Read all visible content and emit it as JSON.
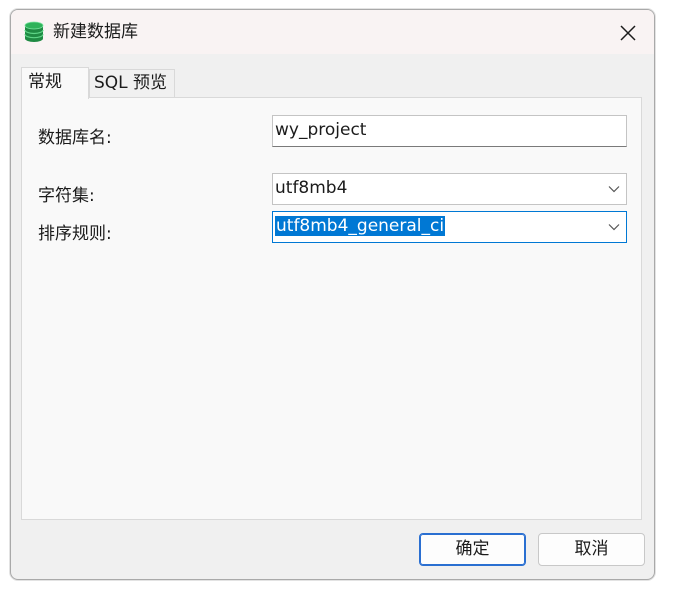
{
  "window": {
    "title": "新建数据库",
    "icon": "database-icon",
    "accent": "#0078d4"
  },
  "tabs": [
    {
      "label": "常规",
      "active": true
    },
    {
      "label": "SQL 预览",
      "active": false
    }
  ],
  "form": {
    "name_label": "数据库名:",
    "name_value": "wy_project",
    "charset_label": "字符集:",
    "charset_value": "utf8mb4",
    "collation_label": "排序规则:",
    "collation_value": "utf8mb4_general_ci"
  },
  "buttons": {
    "ok_label": "确定",
    "cancel_label": "取消"
  }
}
